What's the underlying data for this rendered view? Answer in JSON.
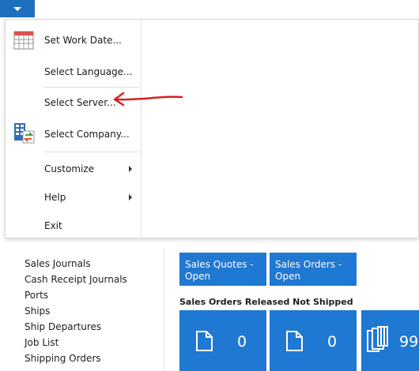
{
  "app_menu": {
    "icon": "chevron-down-icon",
    "items": [
      {
        "label": "Set Work Date...",
        "icon": "calendar-icon"
      },
      {
        "label": "Select Language..."
      },
      {
        "label": "Select Server..."
      },
      {
        "label": "Select Company...",
        "icon": "company-switch-icon"
      },
      {
        "label": "Customize",
        "submenu": true
      },
      {
        "label": "Help",
        "submenu": true
      },
      {
        "label": "Exit"
      }
    ]
  },
  "annotation": {
    "color": "#d92020",
    "points_to": "Select Server..."
  },
  "navigation_pane": {
    "items": [
      "Sales Journals",
      "Cash Receipt Journals",
      "Ports",
      "Ships",
      "Ship Departures",
      "Job List",
      "Shipping Orders"
    ]
  },
  "cues": {
    "tiles": [
      {
        "label": "Sales Quotes - Open"
      },
      {
        "label": "Sales Orders - Open"
      }
    ],
    "section_title": "Sales Orders Released Not Shipped",
    "count_tiles": [
      {
        "icon": "document-icon",
        "value": "0"
      },
      {
        "icon": "document-icon",
        "value": "0"
      },
      {
        "icon": "document-stack-icon",
        "value": "99"
      }
    ]
  },
  "colors": {
    "accent": "#1f78d1",
    "menu_button": "#1f6fbf",
    "annotation": "#d92020"
  }
}
